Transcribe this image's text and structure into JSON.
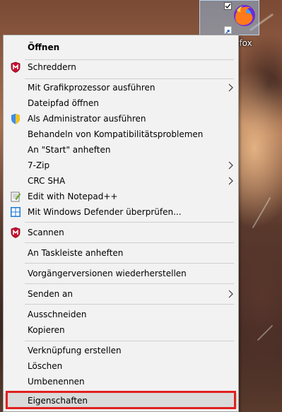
{
  "desktop": {
    "icon_label": "efox",
    "accent": "#99d1ff"
  },
  "menu": {
    "items": [
      {
        "label": "Öffnen",
        "icon": "none",
        "submenu": false,
        "bold": true
      },
      {
        "label": "Schreddern",
        "icon": "mcafee-icon",
        "submenu": false
      },
      {
        "label": "Mit Grafikprozessor ausführen",
        "icon": "none",
        "submenu": true
      },
      {
        "label": "Dateipfad öffnen",
        "icon": "none",
        "submenu": false
      },
      {
        "label": "Als Administrator ausführen",
        "icon": "uac-shield-icon",
        "submenu": false
      },
      {
        "label": "Behandeln von Kompatibilitätsproblemen",
        "icon": "none",
        "submenu": false
      },
      {
        "label": "An \"Start\" anheften",
        "icon": "none",
        "submenu": false
      },
      {
        "label": "7-Zip",
        "icon": "none",
        "submenu": true
      },
      {
        "label": "CRC SHA",
        "icon": "none",
        "submenu": true
      },
      {
        "label": "Edit with Notepad++",
        "icon": "notepad-plus-plus-icon",
        "submenu": false
      },
      {
        "label": "Mit Windows Defender überprüfen...",
        "icon": "windows-defender-icon",
        "submenu": false
      },
      {
        "label": "Scannen",
        "icon": "mcafee-icon",
        "submenu": false
      },
      {
        "label": "An Taskleiste anheften",
        "icon": "none",
        "submenu": false
      },
      {
        "label": "Vorgängerversionen wiederherstellen",
        "icon": "none",
        "submenu": false
      },
      {
        "label": "Senden an",
        "icon": "none",
        "submenu": true
      },
      {
        "label": "Ausschneiden",
        "icon": "none",
        "submenu": false
      },
      {
        "label": "Kopieren",
        "icon": "none",
        "submenu": false
      },
      {
        "label": "Verknüpfung erstellen",
        "icon": "none",
        "submenu": false
      },
      {
        "label": "Löschen",
        "icon": "none",
        "submenu": false
      },
      {
        "label": "Umbenennen",
        "icon": "none",
        "submenu": false
      },
      {
        "label": "Eigenschaften",
        "icon": "none",
        "submenu": false,
        "highlighted": true
      }
    ],
    "highlight_color": "#e0201f"
  }
}
